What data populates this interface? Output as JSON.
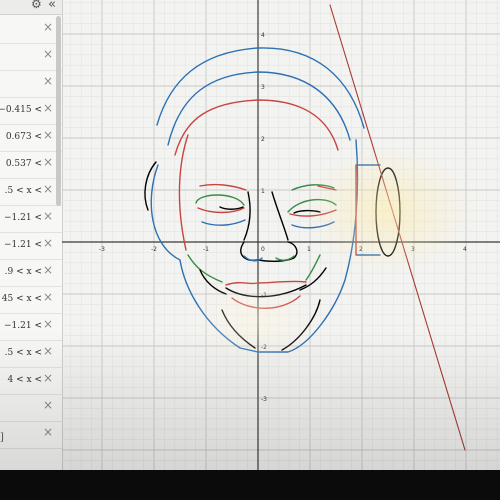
{
  "toolbar": {
    "settings_icon": "gear-icon",
    "collapse_icon": "double-chevron-left-icon",
    "collapse_glyph": "«",
    "settings_glyph": "⚙"
  },
  "expressions": [
    {
      "text": ""
    },
    {
      "text": ""
    },
    {
      "text": ""
    },
    {
      "text": "−0.415 <"
    },
    {
      "text": "0.673 <"
    },
    {
      "text": "0.537 <"
    },
    {
      "text": ".5 < x <"
    },
    {
      "text": "−1.21 <"
    },
    {
      "text": "−1.21 <"
    },
    {
      "text": ".9 < x <"
    },
    {
      "text": "45 < x <"
    },
    {
      "text": "−1.21 <"
    },
    {
      "text": ".5 < x <"
    },
    {
      "text": "4 < x <"
    },
    {
      "text": ""
    },
    {
      "text": ""
    }
  ],
  "delete_glyph": "×",
  "corner_label": "]",
  "graph": {
    "x_ticks": [
      "-3",
      "-2",
      "-1",
      "1",
      "2",
      "3",
      "4"
    ],
    "y_ticks": [
      "4",
      "3",
      "2",
      "1",
      "-1",
      "-2",
      "-3"
    ],
    "origin_label": "0",
    "colors": {
      "blue": "#2d70b3",
      "red": "#c74440",
      "green": "#388c46",
      "black": "#000000",
      "darkred": "#a83a32"
    }
  }
}
